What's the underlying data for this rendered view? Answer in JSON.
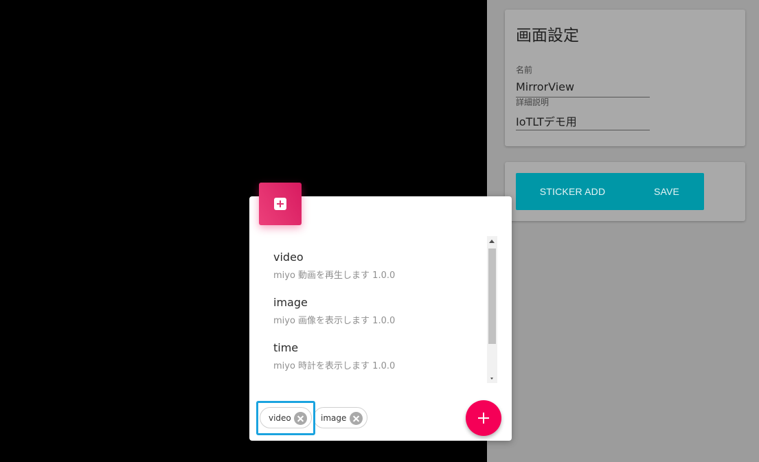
{
  "settings": {
    "title": "画面設定",
    "name_label": "名前",
    "name_value": "MirrorView",
    "description_label": "詳細説明",
    "description_value": "IoTLTデモ用"
  },
  "actions": {
    "sticker_add_label": "STICKER ADD",
    "save_label": "SAVE"
  },
  "sticker_dialog": {
    "header_icon": "plus-square-icon",
    "items": [
      {
        "title": "video",
        "subtitle": "miyo 動画を再生します 1.0.0"
      },
      {
        "title": "image",
        "subtitle": "miyo 画像を表示します 1.0.0"
      },
      {
        "title": "time",
        "subtitle": "miyo 時計を表示します 1.0.0"
      }
    ],
    "chips": [
      {
        "label": "video"
      },
      {
        "label": "image"
      }
    ],
    "add_button_icon": "plus-icon"
  },
  "colors": {
    "accent_teal": "#0097a7",
    "fab_pink": "#f50057",
    "header_pink": "#e91e63",
    "highlight_blue": "#1aa3df"
  }
}
